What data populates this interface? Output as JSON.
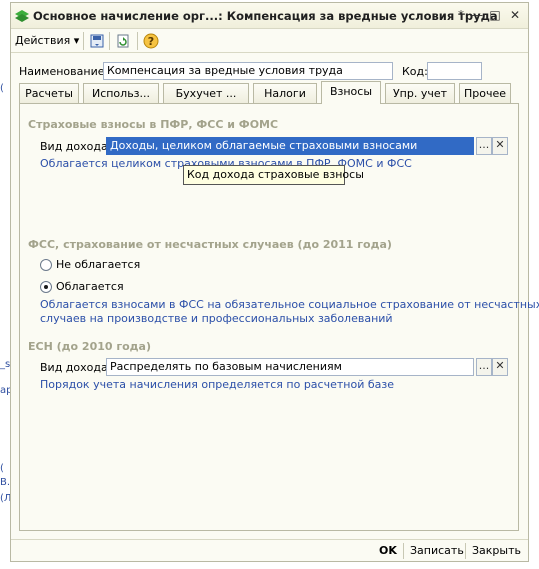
{
  "left_fragments": [
    "_s",
    "ap",
    "B.",
    "(",
    "(Л",
    "("
  ],
  "window": {
    "title": "Основное начисление орг...: Компенсация за вредные условия труда",
    "title_buttons": [
      "*",
      "—",
      "□",
      "✕"
    ]
  },
  "toolbar": {
    "actions_label": "Действия ▾"
  },
  "form": {
    "name_label": "Наименование:",
    "name_value": "Компенсация за вредные условия труда",
    "code_label": "Код:",
    "code_value": ""
  },
  "tabs": [
    {
      "label": "Расчеты",
      "active": false
    },
    {
      "label": "Использ...",
      "active": false
    },
    {
      "label": "Бухучет ...",
      "active": false
    },
    {
      "label": "Налоги",
      "active": false
    },
    {
      "label": "Взносы",
      "active": true
    },
    {
      "label": "Упр. учет",
      "active": false
    },
    {
      "label": "Прочее",
      "active": false
    }
  ],
  "section1": {
    "title": "Страховые взносы в ПФР, ФСС и ФОМС",
    "income_label": "Вид дохода:",
    "income_value": "Доходы, целиком облагаемые страховыми взносами",
    "hint": "Облагается целиком страховыми взносами в ПФР, ФОМС и ФСС",
    "tooltip": "Код дохода страховые взносы"
  },
  "section2": {
    "title": "ФСС, страхование от несчастных случаев (до 2011 года)",
    "option_no": "Не облагается",
    "option_yes": "Облагается",
    "selected": "Облагается",
    "hint_line1": "Облагается взносами в ФСС на обязательное социальное страхование от несчастных",
    "hint_line2": "случаев на производстве и профессиональных заболеваний"
  },
  "section3": {
    "title": "ЕСН (до 2010 года)",
    "income_label": "Вид дохода:",
    "income_value": "Распределять по базовым начислениям",
    "hint": "Порядок учета начисления определяется по расчетной базе"
  },
  "field_buttons": {
    "select": "...",
    "clear": "✕"
  },
  "footer": {
    "ok": "OK",
    "save": "Записать",
    "close": "Закрыть"
  },
  "colors": {
    "section_title": "#a3a38c",
    "hint_text": "#2b4fa8",
    "selection": "#316ac5",
    "window_bg": "#fbfbf3"
  }
}
